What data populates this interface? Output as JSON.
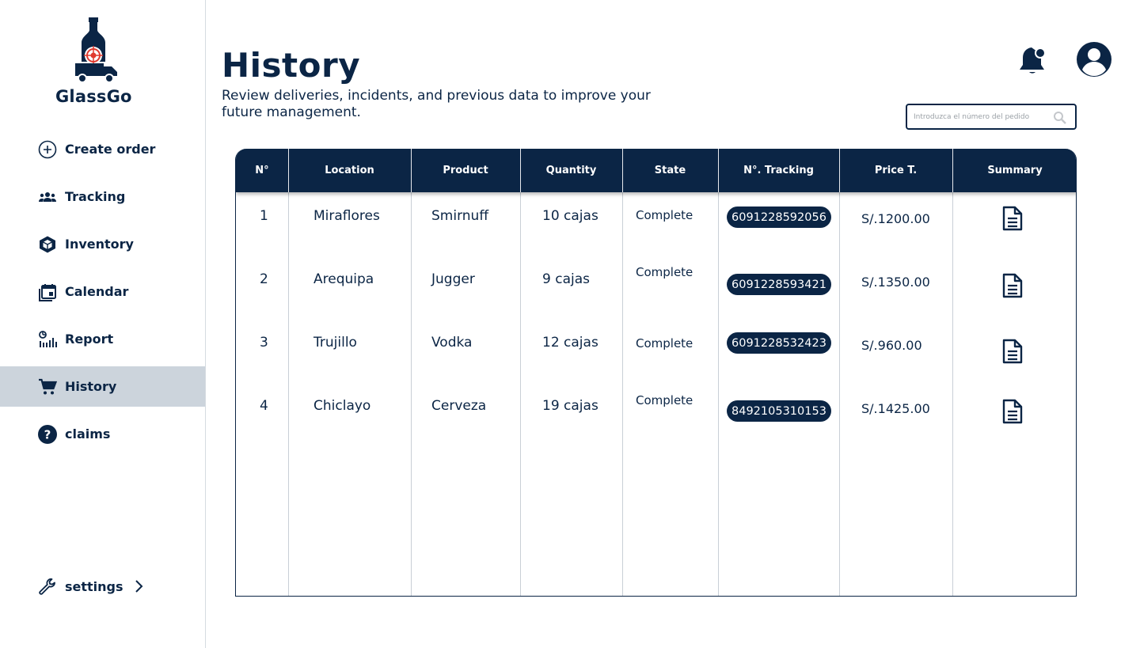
{
  "app": {
    "name": "GlassGo"
  },
  "sidebar": {
    "items": [
      {
        "label": "Create order",
        "icon": "plus-circle-icon"
      },
      {
        "label": "Tracking",
        "icon": "people-group-icon"
      },
      {
        "label": "Inventory",
        "icon": "cube-icon"
      },
      {
        "label": "Calendar",
        "icon": "calendar-icon"
      },
      {
        "label": "Report",
        "icon": "report-chart-icon"
      },
      {
        "label": "History",
        "icon": "cart-icon",
        "active": true
      },
      {
        "label": "claims",
        "icon": "question-circle-icon"
      }
    ],
    "settings": {
      "label": "settings",
      "icon": "wrench-icon"
    }
  },
  "page": {
    "title": "History",
    "subtitle": "Review deliveries, incidents, and previous data to improve your future management."
  },
  "search": {
    "placeholder": "Introduzca el número del pedido"
  },
  "table": {
    "headers": [
      "N°",
      "Location",
      "Product",
      "Quantity",
      "State",
      "N°. Tracking",
      "Price T.",
      "Summary"
    ],
    "rows": [
      {
        "n": "1",
        "location": "Miraflores",
        "product": "Smirnuff",
        "quantity": "10 cajas",
        "state": "Complete",
        "tracking": "6091228592056",
        "price": "S/.1200.00"
      },
      {
        "n": "2",
        "location": "Arequipa",
        "product": "Jugger",
        "quantity": "9 cajas",
        "state": "Complete",
        "tracking": "6091228593421",
        "price": "S/.1350.00"
      },
      {
        "n": "3",
        "location": "Trujillo",
        "product": "Vodka",
        "quantity": "12 cajas",
        "state": "Complete",
        "tracking": "6091228532423",
        "price": "S/.960.00"
      },
      {
        "n": "4",
        "location": "Chiclayo",
        "product": "Cerveza",
        "quantity": "19 cajas",
        "state": "Complete",
        "tracking": "8492105310153",
        "price": "S/.1425.00"
      }
    ]
  },
  "colors": {
    "primary": "#0b2545",
    "active_bg": "#ccd4dc",
    "logo_accent": "#e03a2f"
  }
}
